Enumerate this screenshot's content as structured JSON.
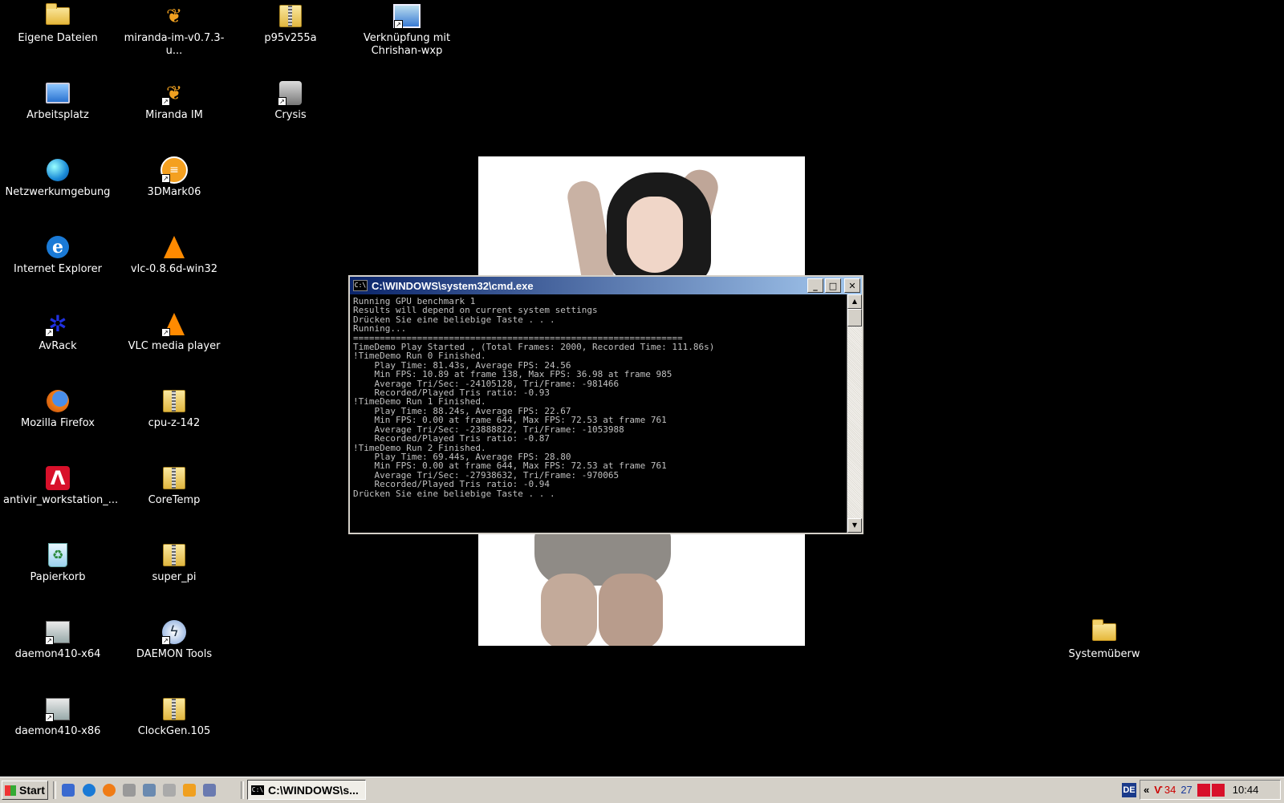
{
  "desktop": {
    "icons": [
      {
        "label": "Eigene Dateien",
        "icon": "folder-icon"
      },
      {
        "label": "Arbeitsplatz",
        "icon": "computer-icon"
      },
      {
        "label": "Netzwerkumgebung",
        "icon": "network-icon"
      },
      {
        "label": "Internet Explorer",
        "icon": "internet-explorer-icon"
      },
      {
        "label": "AvRack",
        "icon": "avrack-icon"
      },
      {
        "label": "Mozilla Firefox",
        "icon": "firefox-icon"
      },
      {
        "label": "antivir_workstation_...",
        "icon": "avira-icon"
      },
      {
        "label": "Papierkorb",
        "icon": "recycle-bin-icon"
      },
      {
        "label": "daemon410-x64",
        "icon": "setup-icon"
      },
      {
        "label": "daemon410-x86",
        "icon": "setup-icon"
      },
      {
        "label": "miranda-im-v0.7.3-u...",
        "icon": "miranda-icon"
      },
      {
        "label": "Miranda IM",
        "icon": "miranda-icon"
      },
      {
        "label": "3DMark06",
        "icon": "3dmark-icon"
      },
      {
        "label": "vlc-0.8.6d-win32",
        "icon": "vlc-icon"
      },
      {
        "label": "VLC media player",
        "icon": "vlc-icon"
      },
      {
        "label": "cpu-z-142",
        "icon": "zip-folder-icon"
      },
      {
        "label": "CoreTemp",
        "icon": "zip-folder-icon"
      },
      {
        "label": "super_pi",
        "icon": "zip-folder-icon"
      },
      {
        "label": "DAEMON Tools",
        "icon": "daemon-tools-icon"
      },
      {
        "label": "ClockGen.105",
        "icon": "zip-folder-icon"
      },
      {
        "label": "p95v255a",
        "icon": "zip-folder-icon"
      },
      {
        "label": "Crysis",
        "icon": "crysis-icon"
      },
      {
        "label": "Verknüpfung mit Chrishan-wxp",
        "icon": "network-shortcut-icon"
      },
      {
        "label": "Systemüberw",
        "icon": "folder-icon"
      }
    ]
  },
  "cmd_window": {
    "title": "C:\\WINDOWS\\system32\\cmd.exe",
    "output": "Running GPU benchmark 1\nResults will depend on current system settings\nDrücken Sie eine beliebige Taste . . .\nRunning...\n==============================================================\nTimeDemo Play Started , (Total Frames: 2000, Recorded Time: 111.86s)\n!TimeDemo Run 0 Finished.\n    Play Time: 81.43s, Average FPS: 24.56\n    Min FPS: 10.89 at frame 138, Max FPS: 36.98 at frame 985\n    Average Tri/Sec: -24105128, Tri/Frame: -981466\n    Recorded/Played Tris ratio: -0.93\n!TimeDemo Run 1 Finished.\n    Play Time: 88.24s, Average FPS: 22.67\n    Min FPS: 0.00 at frame 644, Max FPS: 72.53 at frame 761\n    Average Tri/Sec: -23888822, Tri/Frame: -1053988\n    Recorded/Played Tris ratio: -0.87\n!TimeDemo Run 2 Finished.\n    Play Time: 69.44s, Average FPS: 28.80\n    Min FPS: 0.00 at frame 644, Max FPS: 72.53 at frame 761\n    Average Tri/Sec: -27938632, Tri/Frame: -970065\n    Recorded/Played Tris ratio: -0.94\nDrücken Sie eine beliebige Taste . . ."
  },
  "taskbar": {
    "start_label": "Start",
    "task_button_label": "C:\\WINDOWS\\s...",
    "language": "DE",
    "tray_expand": "«",
    "tray_value_a": "34",
    "tray_value_b": "27",
    "clock": "10:44",
    "colors": {
      "tray_value_a": "#cc0000",
      "tray_value_b": "#1a3a9a"
    }
  }
}
